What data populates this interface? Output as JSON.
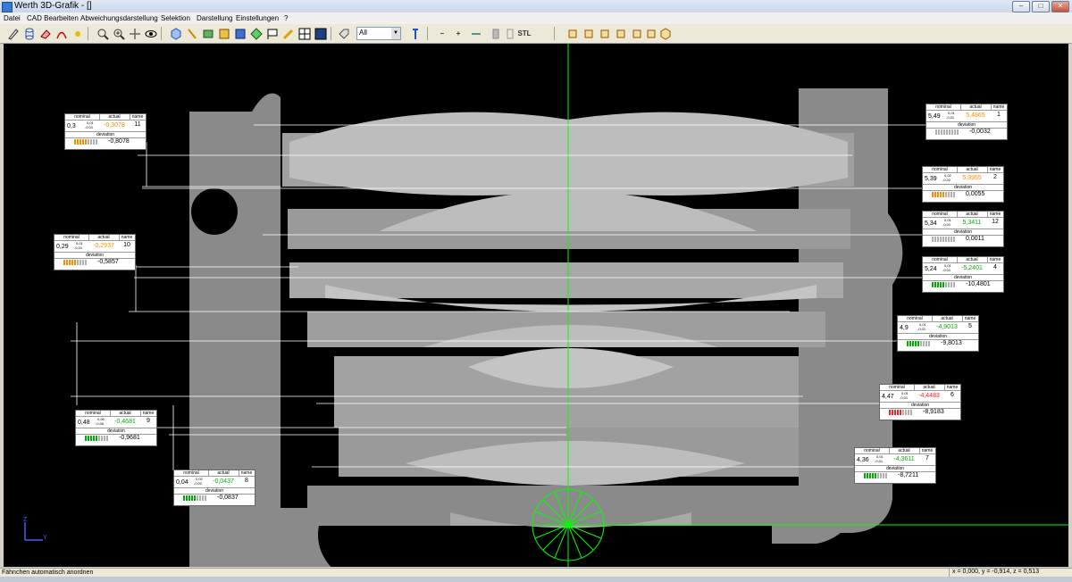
{
  "window": {
    "title": "Werth 3D-Grafik - []"
  },
  "menu": [
    "Datei",
    "CAD Bearbeiten",
    "Abweichungsdarstellung",
    "Selektion",
    "Darstellung",
    "Einstellungen",
    "?"
  ],
  "toolbar": {
    "combo_value": "All",
    "stl_label": "STL",
    "minus_label": "–",
    "plus_label": "+"
  },
  "annotation_headers": {
    "nominal": "nominal",
    "actual": "actual",
    "name": "name",
    "deviation": "deviation"
  },
  "annotations": [
    {
      "name": "11",
      "nominal": "0,3",
      "tol_plus": "0,01",
      "tol_minus": "-0,01",
      "actual": "-0,3078",
      "actual_color": "#ff8c00",
      "deviation": "-0,8078",
      "bar_color": "#ff8c00"
    },
    {
      "name": "10",
      "nominal": "0,29",
      "tol_plus": "0,01",
      "tol_minus": "-0,01",
      "actual": "-0,2937",
      "actual_color": "#ff8c00",
      "deviation": "-0,5857",
      "bar_color": "#ff8c00"
    },
    {
      "name": "9",
      "nominal": "0,48",
      "tol_plus": "0,06",
      "tol_minus": "-0,06",
      "actual": "-0,4681",
      "actual_color": "#00b000",
      "deviation": "-0,9681",
      "bar_color": "#00b000"
    },
    {
      "name": "8",
      "nominal": "0,04",
      "tol_plus": "0,02",
      "tol_minus": "-0,02",
      "actual": "-0,0437",
      "actual_color": "#00b000",
      "deviation": "-0,0837",
      "bar_color": "#00b000"
    },
    {
      "name": "1",
      "nominal": "5,49",
      "tol_plus": "0,01",
      "tol_minus": "-0,01",
      "actual": "5,4865",
      "actual_color": "#ff8c00",
      "deviation": "-0,0032",
      "bar_color": "#b0b0b0"
    },
    {
      "name": "2",
      "nominal": "5,39",
      "tol_plus": "0,02",
      "tol_minus": "-0,02",
      "actual": "5,3955",
      "actual_color": "#ff8c00",
      "deviation": "0,0055",
      "bar_color": "#ff8c00"
    },
    {
      "name": "12",
      "nominal": "5,34",
      "tol_plus": "0,01",
      "tol_minus": "-0,01",
      "actual": "5,3411",
      "actual_color": "#00b000",
      "deviation": "0,0011",
      "bar_color": "#b0b0b0"
    },
    {
      "name": "4",
      "nominal": "5,24",
      "tol_plus": "0,01",
      "tol_minus": "-0,01",
      "actual": "-5,2401",
      "actual_color": "#00b000",
      "deviation": "-10,4801",
      "bar_color": "#00b000"
    },
    {
      "name": "5",
      "nominal": "4,9",
      "tol_plus": "0,01",
      "tol_minus": "-0,01",
      "actual": "-4,9013",
      "actual_color": "#00b000",
      "deviation": "-9,8013",
      "bar_color": "#00b000"
    },
    {
      "name": "6",
      "nominal": "4,47",
      "tol_plus": "0,01",
      "tol_minus": "-0,01",
      "actual": "-4,4483",
      "actual_color": "#ff2020",
      "deviation": "-8,9183",
      "bar_color": "#ff2020"
    },
    {
      "name": "7",
      "nominal": "4,36",
      "tol_plus": "0,01",
      "tol_minus": "-0,01",
      "actual": "-4,3611",
      "actual_color": "#00b000",
      "deviation": "-8,7211",
      "bar_color": "#00b000"
    }
  ],
  "axes": {
    "z": "Z",
    "y": "Y"
  },
  "status": {
    "left": "Fähnchen automatisch anordnen",
    "coords": "x = 0,000, y = -0,914, z = 0,513"
  }
}
